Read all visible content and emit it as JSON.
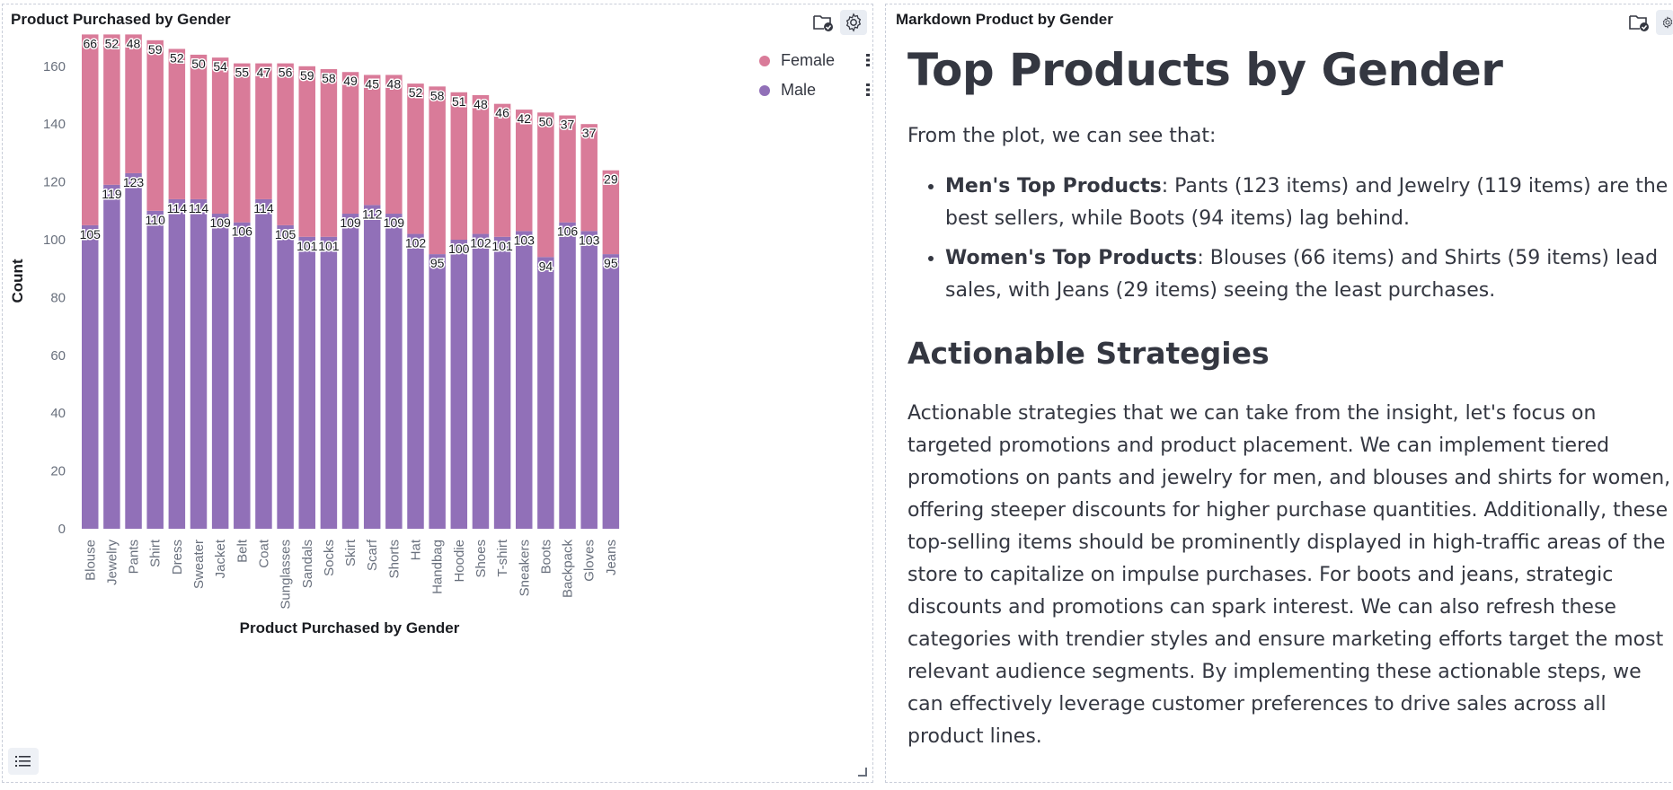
{
  "left_panel": {
    "title": "Product Purchased by Gender",
    "icons": [
      "folder-check-icon",
      "gear-icon"
    ]
  },
  "right_panel": {
    "title": "Markdown Product by Gender",
    "icons": [
      "folder-check-icon",
      "gear-icon"
    ]
  },
  "colors": {
    "female": "#d97b99",
    "male": "#9170b8"
  },
  "chart_data": {
    "type": "bar",
    "stacked": true,
    "title": "",
    "xlabel": "Product Purchased by Gender",
    "ylabel": "Count",
    "ylim": [
      0,
      170
    ],
    "yticks": [
      0,
      20,
      40,
      60,
      80,
      100,
      120,
      140,
      160
    ],
    "legend_position": "top-right",
    "grid": false,
    "categories": [
      "Blouse",
      "Jewelry",
      "Pants",
      "Shirt",
      "Dress",
      "Sweater",
      "Jacket",
      "Belt",
      "Coat",
      "Sunglasses",
      "Sandals",
      "Socks",
      "Skirt",
      "Scarf",
      "Shorts",
      "Hat",
      "Handbag",
      "Hoodie",
      "Shoes",
      "T-shirt",
      "Sneakers",
      "Boots",
      "Backpack",
      "Gloves",
      "Jeans"
    ],
    "series": [
      {
        "name": "Male",
        "values": [
          105,
          119,
          123,
          110,
          114,
          114,
          109,
          106,
          114,
          105,
          101,
          101,
          109,
          112,
          109,
          102,
          95,
          100,
          102,
          101,
          103,
          94,
          106,
          103,
          95
        ]
      },
      {
        "name": "Female",
        "values": [
          66,
          52,
          48,
          59,
          52,
          50,
          54,
          55,
          47,
          56,
          59,
          58,
          49,
          45,
          48,
          52,
          58,
          51,
          48,
          46,
          42,
          50,
          37,
          37,
          29
        ]
      }
    ],
    "legend": [
      "Female",
      "Male"
    ]
  },
  "markdown": {
    "h1": "Top Products by Gender",
    "intro": "From the plot, we can see that:",
    "bullets": [
      {
        "strong": "Men's Top Products",
        "text": ": Pants (123 items) and Jewelry (119 items) are the best sellers, while Boots (94 items) lag behind."
      },
      {
        "strong": "Women's Top Products",
        "text": ": Blouses (66 items) and Shirts (59 items) lead sales, with Jeans (29 items) seeing the least purchases."
      }
    ],
    "h2": "Actionable Strategies",
    "paragraph": "Actionable strategies that we can take from the insight, let's focus on targeted promotions and product placement. We can implement tiered promotions on pants and jewelry for men, and blouses and shirts for women, offering steeper discounts for higher purchase quantities. Additionally, these top-selling items should be prominently displayed in high-traffic areas of the store to capitalize on impulse purchases. For boots and jeans, strategic discounts and promotions can spark interest. We can also refresh these categories with trendier styles and ensure marketing efforts target the most relevant audience segments. By implementing these actionable steps, we can effectively leverage customer preferences to drive sales across all product lines."
  }
}
